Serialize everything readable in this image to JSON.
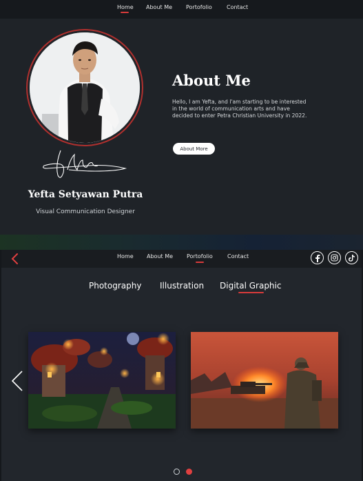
{
  "about_screen": {
    "nav": {
      "items": [
        "Home",
        "About Me",
        "Portofolio",
        "Contact"
      ],
      "active": "Home"
    },
    "profile": {
      "name": "Yefta Setyawan Putra",
      "role": "Visual Communication Designer"
    },
    "about": {
      "title": "About Me",
      "body": "Hello, I am Yefta, and I'am starting to be interested in the world of communication arts and have decided to enter Petra Christian University in 2022.",
      "button_label": "About More"
    }
  },
  "portfolio_screen": {
    "nav": {
      "items": [
        "Home",
        "About Me",
        "Portofolio",
        "Contact"
      ],
      "active": "Portofolio"
    },
    "social_icons": [
      "facebook-icon",
      "instagram-icon",
      "tiktok-icon"
    ],
    "categories": [
      "Photography",
      "Illustration",
      "Digital  Graphic"
    ],
    "active_category": "Digital  Graphic",
    "gallery": {
      "items": [
        "fantasy-mushroom-village-artwork",
        "war-soldier-burning-tank-artwork"
      ],
      "page_count": 2,
      "active_page": 2
    }
  },
  "colors": {
    "accent": "#d93b3b",
    "background": "#1f2328",
    "nav_background": "#16191d",
    "text": "#ffffff"
  }
}
